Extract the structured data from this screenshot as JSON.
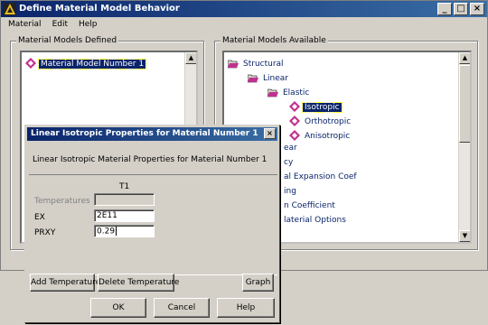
{
  "main_window": {
    "title": "Define Material Model Behavior",
    "minimize": "_",
    "maximize": "□",
    "close": "×"
  },
  "menu": [
    "Material",
    "Edit",
    "Help"
  ],
  "defined_panel": {
    "title": "Material Models Defined",
    "items": [
      {
        "label": "Material Model Number 1"
      }
    ]
  },
  "available_panel": {
    "title": "Material Models Available",
    "tree": [
      {
        "label": "Structural"
      },
      {
        "label": "Linear"
      },
      {
        "label": "Elastic"
      },
      {
        "label": "Isotropic"
      },
      {
        "label": "Orthotropic"
      },
      {
        "label": "Anisotropic"
      },
      {
        "label": "ear"
      },
      {
        "label": "cy"
      },
      {
        "label": "al Expansion Coef"
      },
      {
        "label": "ing"
      },
      {
        "label": "n Coefficient"
      },
      {
        "label": "laterial Options"
      }
    ]
  },
  "dialog": {
    "title": "Linear Isotropic Properties for Material Number 1",
    "close": "×",
    "description": "Linear Isotropic Material Properties for Material Number 1",
    "column_header": "T1",
    "rows": [
      {
        "label": "Temperatures",
        "value": ""
      },
      {
        "label": "EX",
        "value": "2E11"
      },
      {
        "label": "PRXY",
        "value": "0.29"
      }
    ],
    "buttons": {
      "add_temp": "Add Temperature",
      "delete_temp": "Delete Temperature",
      "graph": "Graph",
      "ok": "OK",
      "cancel": "Cancel",
      "help": "Help"
    }
  }
}
